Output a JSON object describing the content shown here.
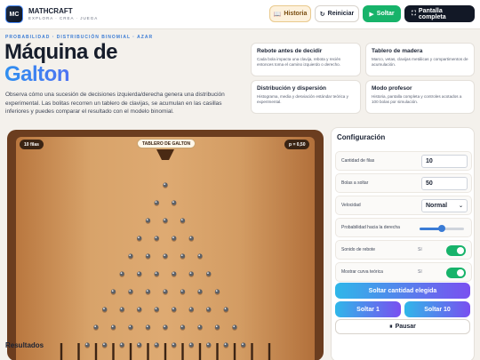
{
  "brand": {
    "logo": "MC",
    "name": "MATHCRAFT",
    "tagline": "EXPLORA · CREA · JUEGA"
  },
  "top_actions": {
    "historia": "Historia",
    "reiniciar": "Reiniciar",
    "soltar": "Soltar",
    "pantalla": "Pantalla completa"
  },
  "hero": {
    "eyebrow": "PROBABILIDAD · DISTRIBUCIÓN BINOMIAL · AZAR",
    "title_line1": "Máquina de",
    "title_line2": "Galton",
    "lead": "Observa cómo una sucesión de decisiones izquierda/derecha genera una distribución experimental. Las bolitas recorren un tablero de clavijas, se acumulan en las casillas inferiores y puedes comparar el resultado con el modelo binomial."
  },
  "features": [
    {
      "title": "Rebote antes de decidir",
      "text": "Cada bola impacta una clavija, rebota y recién entonces toma el camino izquierdo o derecho."
    },
    {
      "title": "Tablero de madera",
      "text": "Marco, vetas, clavijas metálicas y compartimentos de acumulación."
    },
    {
      "title": "Distribución y dispersión",
      "text": "Histograma, media y desviación estándar teórica y experimental."
    },
    {
      "title": "Modo profesor",
      "text": "Historia, pantalla completa y controles acotados a 100 bolas por simulación."
    }
  ],
  "board": {
    "rows_badge": "10 filas",
    "title_badge": "TABLERO DE GALTON",
    "p_badge": "p = 0,50",
    "peg_rows": 10
  },
  "config": {
    "title": "Configuración",
    "rows_label": "Cantidad de filas",
    "rows_value": "10",
    "balls_label": "Bolas a soltar",
    "balls_value": "50",
    "speed_label": "Velocidad",
    "speed_value": "Normal",
    "prob_label": "Probabilidad hacia la derecha",
    "prob_value": 0.5,
    "sound_label": "Sonido de rebote",
    "sound_value": "Sí",
    "curve_label": "Mostrar curva teórica",
    "curve_value": "Sí",
    "drop_chosen": "Soltar cantidad elegida",
    "drop_1": "Soltar 1",
    "drop_10": "Soltar 10",
    "pause": "Pausar"
  },
  "results": {
    "title": "Resultados"
  },
  "colors": {
    "accent": "#3a7bd5",
    "success": "#17b36a",
    "dark": "#121826",
    "wood_light": "#deaa72",
    "wood_dark": "#6b3d1f"
  }
}
